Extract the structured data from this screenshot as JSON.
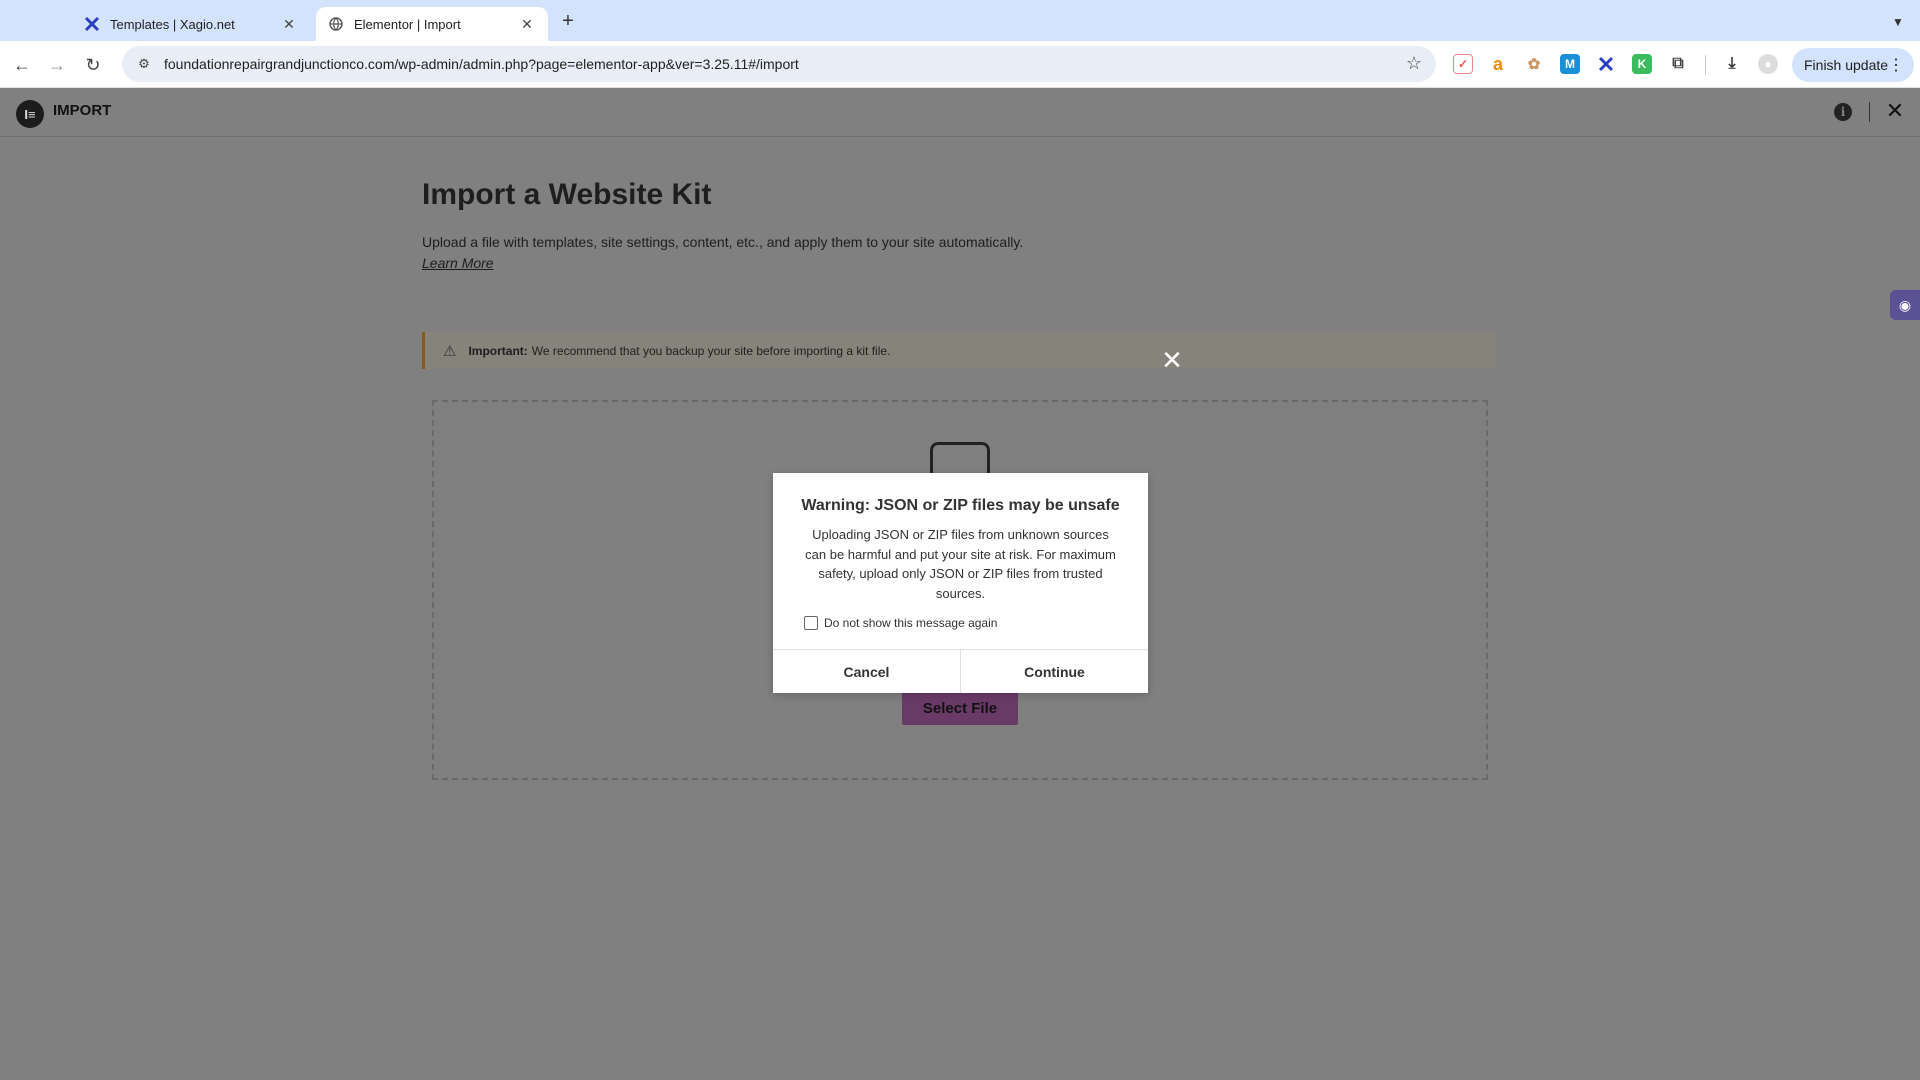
{
  "browser": {
    "tabs": [
      {
        "title": "Templates | Xagio.net",
        "active": false
      },
      {
        "title": "Elementor | Import",
        "active": true
      }
    ],
    "url": "foundationrepairgrandjunctionco.com/wp-admin/admin.php?page=elementor-app&ver=3.25.11#/import",
    "finish_update_label": "Finish update"
  },
  "app": {
    "header_title": "IMPORT",
    "page_title": "Import a Website Kit",
    "description": "Upload a file with templates, site settings, content, etc., and apply them to your site automatically.",
    "learn_more": "Learn More",
    "notice_bold": "Important:",
    "notice_text": "We recommend that you backup your site before importing a kit file.",
    "select_file_label": "Select File"
  },
  "modal": {
    "title": "Warning: JSON or ZIP files may be unsafe",
    "body": "Uploading JSON or ZIP files from unknown sources can be harmful and put your site at risk. For maximum safety, upload only JSON or ZIP files from trusted sources.",
    "checkbox_label": "Do not show this message again",
    "cancel_label": "Cancel",
    "continue_label": "Continue"
  },
  "colors": {
    "overlay": "#808080",
    "tabbar": "#d3e3fd",
    "select_file_bg": "#6a3a67"
  }
}
